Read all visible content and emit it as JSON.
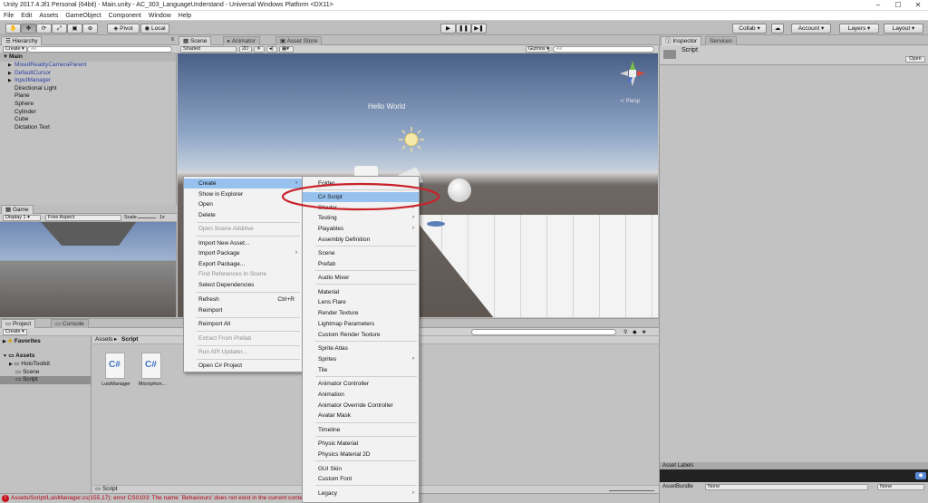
{
  "window": {
    "title": "Unity 2017.4.3f1 Personal (64bit) - Main.unity - AC_303_LanguageUnderstand - Universal Windows Platform <DX11>",
    "controls": [
      "–",
      "☐",
      "✕"
    ]
  },
  "menubar": [
    "File",
    "Edit",
    "Assets",
    "GameObject",
    "Component",
    "Window",
    "Help"
  ],
  "toolbar": {
    "pivot": "Pivot",
    "local": "Local",
    "collab": "Collab ▾",
    "account": "Account ▾",
    "layers": "Layers ▾",
    "layout": "Layout ▾"
  },
  "hierarchy": {
    "tab": "Hierarchy",
    "create": "Create ▾",
    "search_placeholder": "All",
    "scene": "Main",
    "items": [
      {
        "label": "MixedRealityCameraParent",
        "prefab": true,
        "arrow": true
      },
      {
        "label": "DefaultCursor",
        "prefab": true,
        "arrow": true
      },
      {
        "label": "InputManager",
        "prefab": true,
        "arrow": true
      },
      {
        "label": "Directional Light",
        "prefab": false,
        "arrow": false
      },
      {
        "label": "Plane",
        "prefab": false,
        "arrow": false
      },
      {
        "label": "Sphere",
        "prefab": false,
        "arrow": false
      },
      {
        "label": "Cylinder",
        "prefab": false,
        "arrow": false
      },
      {
        "label": "Cube",
        "prefab": false,
        "arrow": false
      },
      {
        "label": "Dictation Text",
        "prefab": false,
        "arrow": false
      }
    ]
  },
  "game": {
    "tab": "Game",
    "display": "Display 1",
    "aspect": "Free Aspect",
    "scale_label": "Scale",
    "scale_value": "1x"
  },
  "scene": {
    "tabs": [
      "Scene",
      "Animator",
      "Asset Store"
    ],
    "shaded": "Shaded",
    "mode2d": "2D",
    "gizmos": "Gizmos ▾",
    "search_placeholder": "All",
    "hello": "Hello World",
    "persp": "Persp"
  },
  "inspector": {
    "tabs": [
      "Inspector",
      "Services"
    ],
    "object": "Script",
    "open": "Open",
    "asset_labels": "Asset Labels",
    "assetbundle_label": "AssetBundle",
    "assetbundle_value": "None",
    "variant_value": "None"
  },
  "project": {
    "tabs": [
      "Project",
      "Console"
    ],
    "create": "Create ▾",
    "favorites": "Favorites",
    "assets": "Assets",
    "folders": [
      "HoloToolkit",
      "Scene",
      "Script"
    ],
    "breadcrumb": [
      "Assets",
      "Script"
    ],
    "files": [
      {
        "name": "LuisManager",
        "icon": "C#"
      },
      {
        "name": "Microphon...",
        "icon": "C#"
      }
    ],
    "footer_path": "Script"
  },
  "status": {
    "error": "Assets/Script/LuisManager.cs(155,17): error CS0103: The name `Behaviours' does not exist in the current context"
  },
  "context_menu": {
    "items": [
      {
        "label": "Create",
        "sub": true,
        "sel": true
      },
      {
        "label": "Show in Explorer"
      },
      {
        "label": "Open"
      },
      {
        "label": "Delete"
      },
      {
        "label": "Open Scene Additive",
        "dis": true
      },
      {
        "label": "Import New Asset..."
      },
      {
        "label": "Import Package",
        "sub": true
      },
      {
        "label": "Export Package..."
      },
      {
        "label": "Find References In Scene",
        "dis": true
      },
      {
        "label": "Select Dependencies"
      },
      {
        "label": "Refresh",
        "shortcut": "Ctrl+R"
      },
      {
        "label": "Reimport"
      },
      {
        "label": "Reimport All"
      },
      {
        "label": "Extract From Prefab",
        "dis": true
      },
      {
        "label": "Run API Updater...",
        "dis": true
      },
      {
        "label": "Open C# Project"
      }
    ]
  },
  "create_menu": {
    "items": [
      {
        "label": "Folder"
      },
      {
        "label": "C# Script",
        "sel": true
      },
      {
        "label": "Shader",
        "sub": true
      },
      {
        "label": "Testing",
        "sub": true
      },
      {
        "label": "Playables",
        "sub": true
      },
      {
        "label": "Assembly Definition"
      },
      {
        "label": "Scene"
      },
      {
        "label": "Prefab"
      },
      {
        "label": "Audio Mixer"
      },
      {
        "label": "Material"
      },
      {
        "label": "Lens Flare"
      },
      {
        "label": "Render Texture"
      },
      {
        "label": "Lightmap Parameters"
      },
      {
        "label": "Custom Render Texture"
      },
      {
        "label": "Sprite Atlas"
      },
      {
        "label": "Sprites",
        "sub": true
      },
      {
        "label": "Tile"
      },
      {
        "label": "Animator Controller"
      },
      {
        "label": "Animation"
      },
      {
        "label": "Animator Override Controller"
      },
      {
        "label": "Avatar Mask"
      },
      {
        "label": "Timeline"
      },
      {
        "label": "Physic Material"
      },
      {
        "label": "Physics Material 2D"
      },
      {
        "label": "GUI Skin"
      },
      {
        "label": "Custom Font"
      },
      {
        "label": "Legacy",
        "sub": true
      }
    ]
  },
  "colors": {
    "highlight": "#97c2ef",
    "annotation": "#c8222a",
    "error": "#c8101c"
  }
}
